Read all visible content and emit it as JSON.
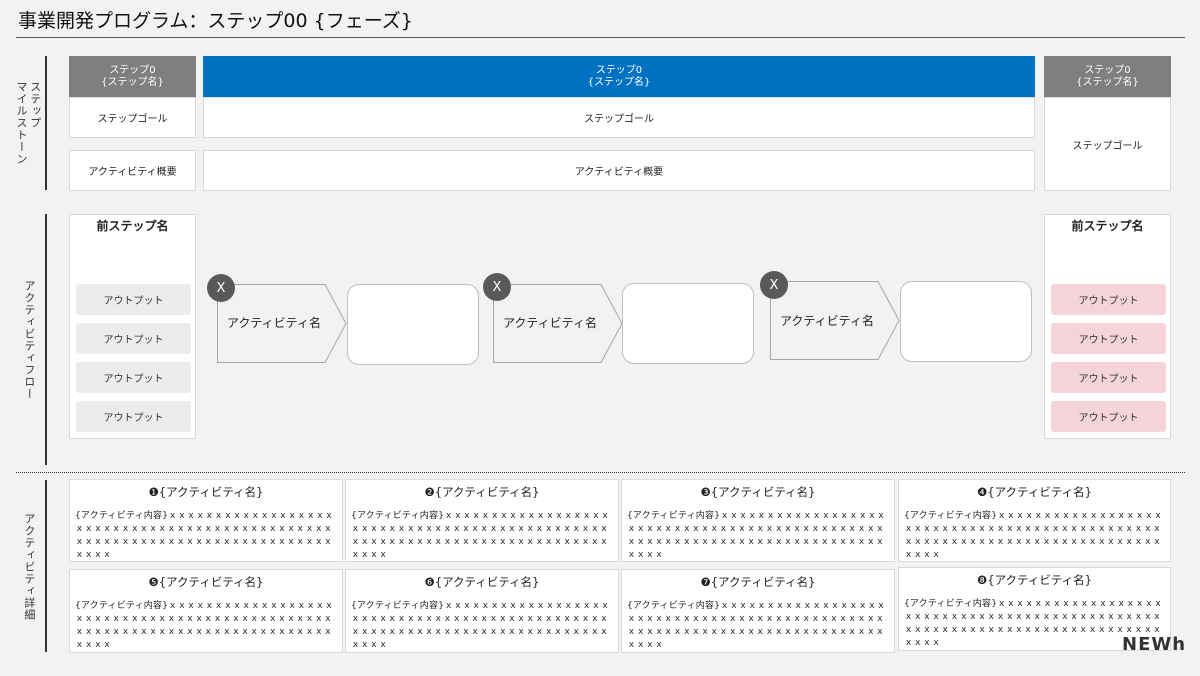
{
  "title": "事業開発プログラム：ステップ00 {フェーズ}",
  "sections": {
    "milestone": "ステップ\nマイルストーン",
    "flow": "アクティビティフロー",
    "detail": "アクティビティ詳細"
  },
  "milestones": {
    "left": {
      "line1": "ステップ0",
      "line2": "{ステップ名}",
      "goal": "ステップゴール",
      "summary": "アクティビティ概要"
    },
    "center": {
      "line1": "ステップ0",
      "line2": "{ステップ名}",
      "goal": "ステップゴール",
      "summary": "アクティビティ概要"
    },
    "right": {
      "line1": "ステップ0",
      "line2": "{ステップ名}",
      "goal": "ステップゴール"
    }
  },
  "flow": {
    "prev_panel": {
      "title": "前ステップ名",
      "outputs": [
        "アウトプット",
        "アウトプット",
        "アウトプット",
        "アウトプット"
      ]
    },
    "next_panel": {
      "title": "前ステップ名",
      "outputs": [
        "アウトプット",
        "アウトプット",
        "アウトプット",
        "アウトプット"
      ]
    },
    "activities": [
      {
        "badge": "X",
        "label": "アクティビティ名"
      },
      {
        "badge": "X",
        "label": "アクティビティ名"
      },
      {
        "badge": "X",
        "label": "アクティビティ名"
      }
    ]
  },
  "details": [
    {
      "title": "❶{アクティビティ名}",
      "body": "{アクティビティ内容}ｘｘｘｘｘｘｘｘｘｘｘｘｘｘｘｘｘｘｘｘｘｘｘｘｘｘｘｘｘｘｘｘｘｘｘｘｘｘｘｘｘｘｘｘｘｘｘｘｘｘｘｘｘｘｘｘｘｘｘｘｘｘｘｘｘｘｘｘｘｘｘｘｘｘｘｘｘｘ"
    },
    {
      "title": "❷{アクティビティ名}",
      "body": "{アクティビティ内容}ｘｘｘｘｘｘｘｘｘｘｘｘｘｘｘｘｘｘｘｘｘｘｘｘｘｘｘｘｘｘｘｘｘｘｘｘｘｘｘｘｘｘｘｘｘｘｘｘｘｘｘｘｘｘｘｘｘｘｘｘｘｘｘｘｘｘｘｘｘｘｘｘｘｘｘｘｘｘ"
    },
    {
      "title": "❸{アクティビティ名}",
      "body": "{アクティビティ内容}ｘｘｘｘｘｘｘｘｘｘｘｘｘｘｘｘｘｘｘｘｘｘｘｘｘｘｘｘｘｘｘｘｘｘｘｘｘｘｘｘｘｘｘｘｘｘｘｘｘｘｘｘｘｘｘｘｘｘｘｘｘｘｘｘｘｘｘｘｘｘｘｘｘｘｘｘｘｘ"
    },
    {
      "title": "❹{アクティビティ名}",
      "body": "{アクティビティ内容}ｘｘｘｘｘｘｘｘｘｘｘｘｘｘｘｘｘｘｘｘｘｘｘｘｘｘｘｘｘｘｘｘｘｘｘｘｘｘｘｘｘｘｘｘｘｘｘｘｘｘｘｘｘｘｘｘｘｘｘｘｘｘｘｘｘｘｘｘｘｘｘｘｘｘｘｘｘｘ"
    },
    {
      "title": "❺{アクティビティ名}",
      "body": "{アクティビティ内容}ｘｘｘｘｘｘｘｘｘｘｘｘｘｘｘｘｘｘｘｘｘｘｘｘｘｘｘｘｘｘｘｘｘｘｘｘｘｘｘｘｘｘｘｘｘｘｘｘｘｘｘｘｘｘｘｘｘｘｘｘｘｘｘｘｘｘｘｘｘｘｘｘｘｘｘｘｘｘ"
    },
    {
      "title": "❻{アクティビティ名}",
      "body": "{アクティビティ内容}ｘｘｘｘｘｘｘｘｘｘｘｘｘｘｘｘｘｘｘｘｘｘｘｘｘｘｘｘｘｘｘｘｘｘｘｘｘｘｘｘｘｘｘｘｘｘｘｘｘｘｘｘｘｘｘｘｘｘｘｘｘｘｘｘｘｘｘｘｘｘｘｘｘｘｘｘｘｘ"
    },
    {
      "title": "❼{アクティビティ名}",
      "body": "{アクティビティ内容}ｘｘｘｘｘｘｘｘｘｘｘｘｘｘｘｘｘｘｘｘｘｘｘｘｘｘｘｘｘｘｘｘｘｘｘｘｘｘｘｘｘｘｘｘｘｘｘｘｘｘｘｘｘｘｘｘｘｘｘｘｘｘｘｘｘｘｘｘｘｘｘｘｘｘｘｘｘｘ"
    },
    {
      "title": "❽{アクティビティ名}",
      "body": "{アクティビティ内容}ｘｘｘｘｘｘｘｘｘｘｘｘｘｘｘｘｘｘｘｘｘｘｘｘｘｘｘｘｘｘｘｘｘｘｘｘｘｘｘｘｘｘｘｘｘｘｘｘｘｘｘｘｘｘｘｘｘｘｘｘｘｘｘｘｘｘｘｘｘｘｘｘｘｘｘｘｘｘ"
    }
  ],
  "logo": "NEWh",
  "colors": {
    "accent": "#0070c0",
    "header_grey": "#7f7f7f",
    "output_pink": "#f4d4d9",
    "badge": "#595959"
  }
}
